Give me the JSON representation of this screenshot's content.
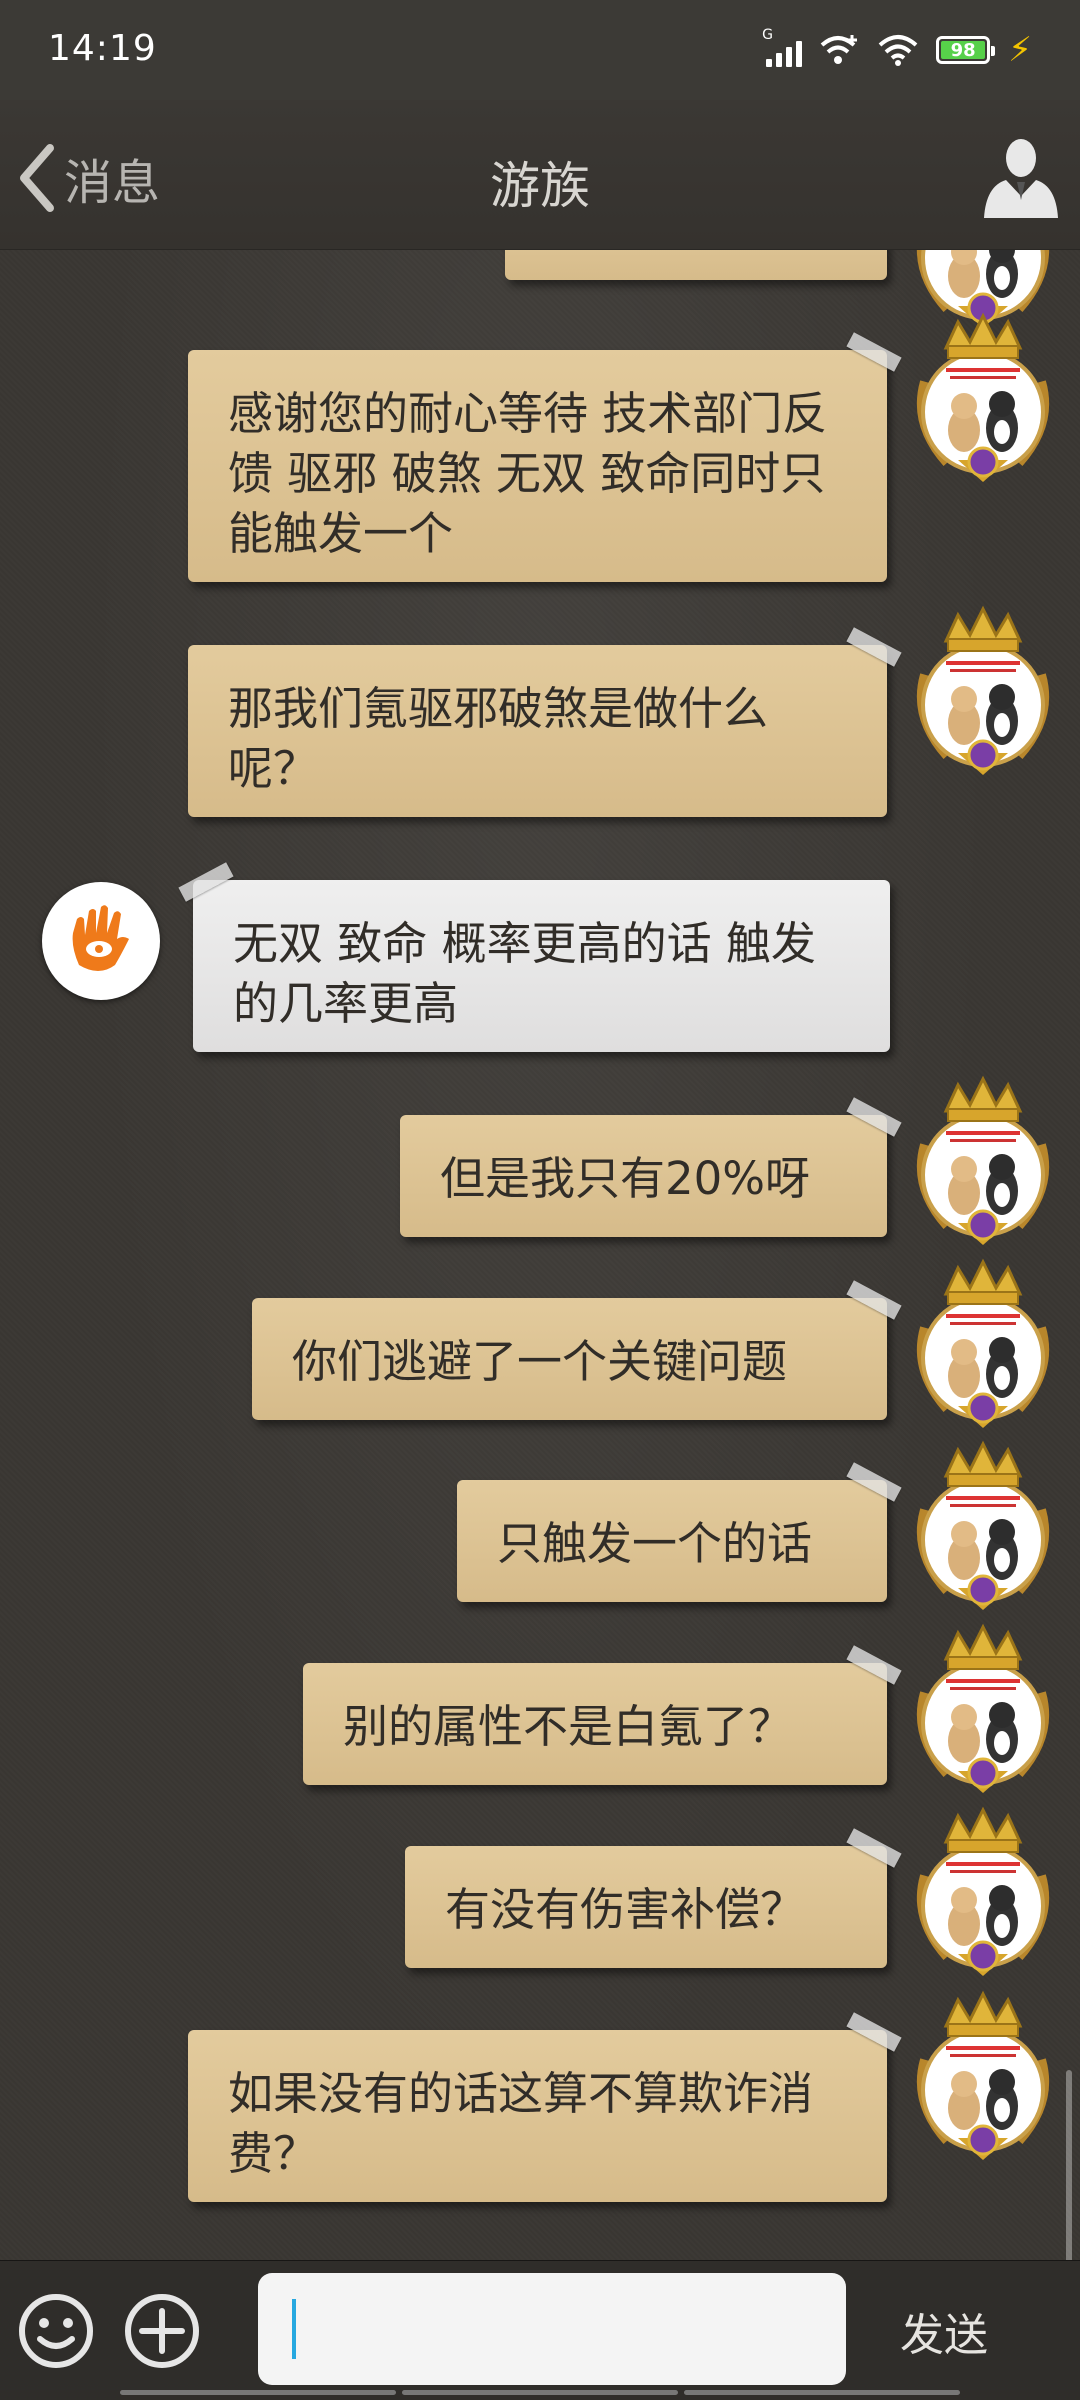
{
  "status_bar": {
    "time": "14:19",
    "network": "G",
    "battery": "98"
  },
  "header": {
    "back_label": "消息",
    "title": "游族"
  },
  "messages": [
    {
      "from": "me",
      "text": "感谢您的耐心等待 技术部门反馈 驱邪 破煞 无双 致命同时只能触发一个"
    },
    {
      "from": "me",
      "text": "那我们氪驱邪破煞是做什么呢？"
    },
    {
      "from": "service",
      "text": "无双 致命 概率更高的话 触发的几率更高"
    },
    {
      "from": "me",
      "text": "但是我只有20%呀"
    },
    {
      "from": "me",
      "text": "你们逃避了一个关键问题"
    },
    {
      "from": "me",
      "text": "只触发一个的话"
    },
    {
      "from": "me",
      "text": "别的属性不是白氪了？"
    },
    {
      "from": "me",
      "text": "有没有伤害补偿？"
    },
    {
      "from": "me",
      "text": "如果没有的话这算不算欺诈消费？"
    }
  ],
  "input": {
    "placeholder": "",
    "send_label": "发送"
  },
  "icons": {
    "back": "chevron-left-icon",
    "profile": "user-silhouette-icon",
    "emoji": "smiley-icon",
    "plus": "plus-circle-icon",
    "service_avatar": "hand-logo-icon"
  },
  "colors": {
    "my_bubble": "#dcc394",
    "their_bubble": "#e7e6e6",
    "accent_logo": "#ef7a1a"
  }
}
